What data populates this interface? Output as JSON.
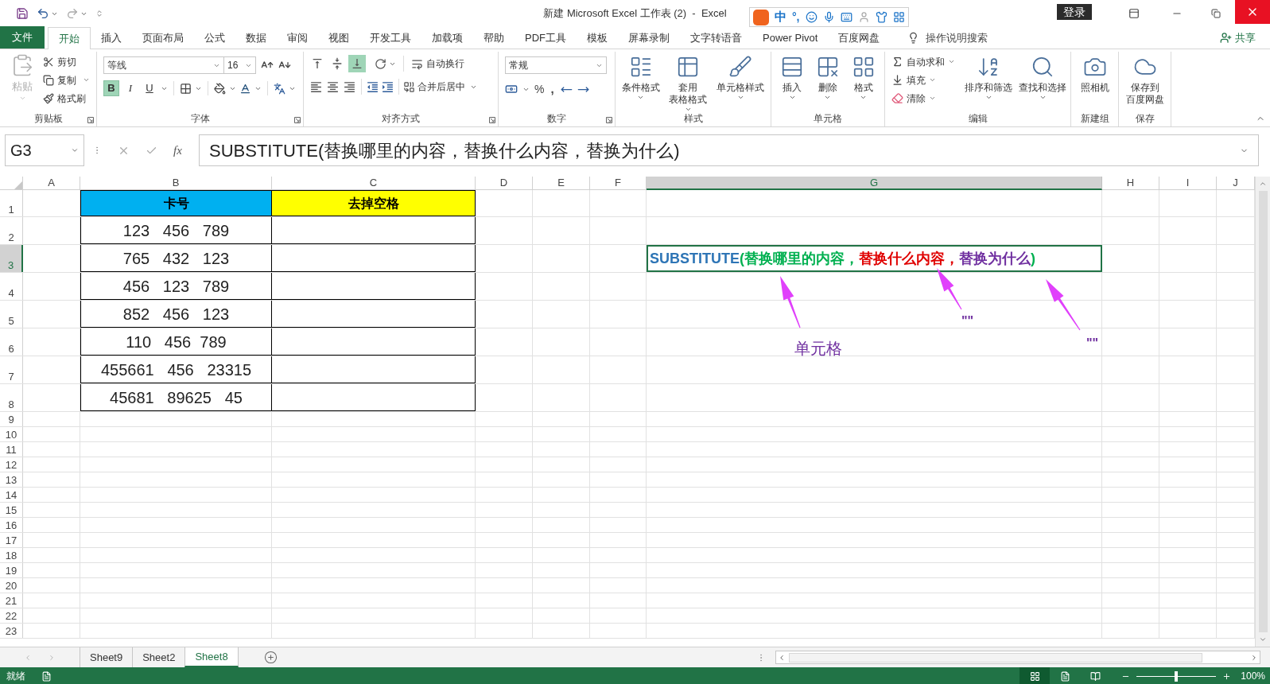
{
  "title_bar": {
    "title": "新建 Microsoft Excel 工作表 (2)  -  Excel",
    "sign_in": "登录"
  },
  "ime_toolbar": {
    "items": [
      "中",
      "°,"
    ]
  },
  "tabs": [
    {
      "label": "文件",
      "kind": "file",
      "selected": false
    },
    {
      "label": "开始",
      "kind": "tab",
      "selected": true
    },
    {
      "label": "插入",
      "kind": "tab",
      "selected": false
    },
    {
      "label": "页面布局",
      "kind": "tab",
      "selected": false
    },
    {
      "label": "公式",
      "kind": "tab",
      "selected": false
    },
    {
      "label": "数据",
      "kind": "tab",
      "selected": false
    },
    {
      "label": "审阅",
      "kind": "tab",
      "selected": false
    },
    {
      "label": "视图",
      "kind": "tab",
      "selected": false
    },
    {
      "label": "开发工具",
      "kind": "tab",
      "selected": false
    },
    {
      "label": "加载项",
      "kind": "tab",
      "selected": false
    },
    {
      "label": "帮助",
      "kind": "tab",
      "selected": false
    },
    {
      "label": "PDF工具",
      "kind": "tab",
      "selected": false
    },
    {
      "label": "模板",
      "kind": "tab",
      "selected": false
    },
    {
      "label": "屏幕录制",
      "kind": "tab",
      "selected": false
    },
    {
      "label": "文字转语音",
      "kind": "tab",
      "selected": false
    },
    {
      "label": "Power Pivot",
      "kind": "tab",
      "selected": false
    },
    {
      "label": "百度网盘",
      "kind": "tab",
      "selected": false
    }
  ],
  "tell_me": "操作说明搜索",
  "share": "共享",
  "ribbon": {
    "clipboard": {
      "label": "剪贴板",
      "paste": {
        "label": "粘贴",
        "disabled": true
      },
      "items": [
        {
          "label": "剪切",
          "dropdown": false
        },
        {
          "label": "复制",
          "dropdown": true
        },
        {
          "label": "格式刷",
          "dropdown": false
        }
      ]
    },
    "font": {
      "label": "字体",
      "font_name": "等线",
      "font_size": "16",
      "styles": [
        {
          "label": "B",
          "on": true
        },
        {
          "label": "I",
          "on": false
        },
        {
          "label": "U",
          "on": false
        }
      ]
    },
    "alignment": {
      "label": "对齐方式",
      "vertical": [
        {
          "selected": false
        },
        {
          "selected": false
        },
        {
          "selected": true
        }
      ],
      "wrap": "自动换行",
      "merge": "合并后居中"
    },
    "number": {
      "label": "数字",
      "format": "常规",
      "percent": "%",
      "comma": ","
    },
    "styles": {
      "label": "样式",
      "buttons": [
        {
          "lines": [
            "条件格式"
          ]
        },
        {
          "lines": [
            "套用",
            "表格格式"
          ]
        },
        {
          "lines": [
            "单元格样式"
          ]
        }
      ]
    },
    "cells": {
      "label": "单元格",
      "buttons": [
        "插入",
        "删除",
        "格式"
      ]
    },
    "editing": {
      "label": "编辑",
      "small": [
        {
          "label": "自动求和",
          "dropdown": true
        },
        {
          "label": "填充",
          "dropdown": true
        },
        {
          "label": "清除",
          "dropdown": true
        }
      ],
      "big": [
        "排序和筛选",
        "查找和选择"
      ]
    },
    "new_group": {
      "label": "新建组",
      "button": "照相机"
    },
    "save": {
      "label": "保存",
      "button": [
        "保存到",
        "百度网盘"
      ]
    }
  },
  "formula_bar": {
    "name_box": "G3",
    "fx": "fx",
    "formula": "SUBSTITUTE(替换哪里的内容，替换什么内容，替换为什么)"
  },
  "sheet": {
    "columns": [
      {
        "label": "A",
        "selected": false
      },
      {
        "label": "B",
        "selected": false
      },
      {
        "label": "C",
        "selected": false
      },
      {
        "label": "D",
        "selected": false
      },
      {
        "label": "E",
        "selected": false
      },
      {
        "label": "F",
        "selected": false
      },
      {
        "label": "G",
        "selected": true
      },
      {
        "label": "H",
        "selected": false
      },
      {
        "label": "I",
        "selected": false
      },
      {
        "label": "J",
        "selected": false
      }
    ],
    "rows": [
      {
        "label": "1",
        "selected": false
      },
      {
        "label": "2",
        "selected": false
      },
      {
        "label": "3",
        "selected": true
      },
      {
        "label": "4",
        "selected": false
      },
      {
        "label": "5",
        "selected": false
      },
      {
        "label": "6",
        "selected": false
      },
      {
        "label": "7",
        "selected": false
      },
      {
        "label": "8",
        "selected": false
      },
      {
        "label": "9",
        "selected": false
      },
      {
        "label": "10",
        "selected": false
      },
      {
        "label": "11",
        "selected": false
      },
      {
        "label": "12",
        "selected": false
      },
      {
        "label": "13",
        "selected": false
      },
      {
        "label": "14",
        "selected": false
      },
      {
        "label": "15",
        "selected": false
      },
      {
        "label": "16",
        "selected": false
      },
      {
        "label": "17",
        "selected": false
      },
      {
        "label": "18",
        "selected": false
      },
      {
        "label": "19",
        "selected": false
      },
      {
        "label": "20",
        "selected": false
      },
      {
        "label": "21",
        "selected": false
      },
      {
        "label": "22",
        "selected": false
      },
      {
        "label": "23",
        "selected": false
      }
    ],
    "table": {
      "header": [
        {
          "text": "卡号",
          "color": "#00b0f0"
        },
        {
          "text": "去掉空格",
          "color": "#ffff00"
        }
      ],
      "rows": [
        "123   456   789",
        "765   432   123",
        "456   123   789",
        "852   456   123",
        "110   456  789",
        "455661   456   23315",
        "45681   89625   45"
      ]
    },
    "active_cell": {
      "segments": [
        {
          "text": "SUBSTITUTE",
          "color": "#2e75b6"
        },
        {
          "text": "(替换哪里的内容，",
          "color": "#00b050"
        },
        {
          "text": "替换什么内容，",
          "color": "#e00000"
        },
        {
          "text": "替换为什么",
          "color": "#7030a0"
        },
        {
          "text": ")",
          "color": "#00b050"
        }
      ]
    },
    "annotations": [
      {
        "text": "单元格"
      },
      {
        "text": "\"\""
      },
      {
        "text": "\"\""
      }
    ]
  },
  "sheet_tabs": [
    {
      "label": "Sheet9",
      "selected": false
    },
    {
      "label": "Sheet2",
      "selected": false
    },
    {
      "label": "Sheet8",
      "selected": true
    }
  ],
  "status_bar": {
    "status": "就绪",
    "views": [
      {
        "selected": true
      },
      {
        "selected": false
      },
      {
        "selected": false
      }
    ],
    "zoom": {
      "level": 0.5,
      "label": "100%"
    }
  }
}
